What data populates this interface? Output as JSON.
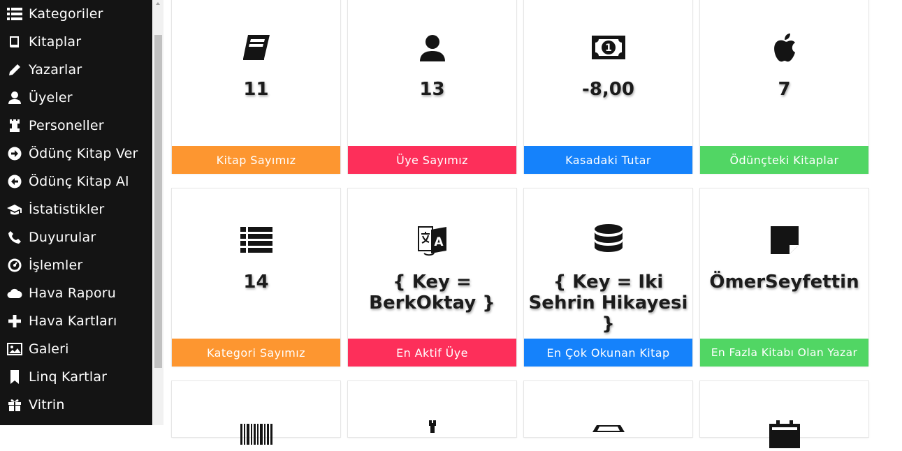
{
  "sidebar": {
    "items": [
      {
        "label": "Kategoriler",
        "icon": "list-icon"
      },
      {
        "label": "Kitaplar",
        "icon": "book-icon"
      },
      {
        "label": "Yazarlar",
        "icon": "pencil-icon"
      },
      {
        "label": "Üyeler",
        "icon": "user-icon"
      },
      {
        "label": "Personeller",
        "icon": "tower-icon"
      },
      {
        "label": "Ödünç Kitap Ver",
        "icon": "circle-arrow-right-icon"
      },
      {
        "label": "Ödünç Kitap Al",
        "icon": "circle-arrow-left-icon"
      },
      {
        "label": "İstatistikler",
        "icon": "education-icon"
      },
      {
        "label": "Duyurular",
        "icon": "phone-icon"
      },
      {
        "label": "İşlemler",
        "icon": "dashboard-icon"
      },
      {
        "label": "Hava Raporu",
        "icon": "cloud-icon"
      },
      {
        "label": "Hava Kartları",
        "icon": "plus-icon"
      },
      {
        "label": "Galeri",
        "icon": "picture-icon"
      },
      {
        "label": "Linq Kartlar",
        "icon": "bookmark-icon"
      },
      {
        "label": "Vitrin",
        "icon": "gift-icon"
      }
    ]
  },
  "cards": [
    {
      "value": "11",
      "label": "Kitap Sayımız",
      "icon": "book-icon",
      "color": "#fd9630"
    },
    {
      "value": "13",
      "label": "Üye Sayımız",
      "icon": "user-icon",
      "color": "#fd2f5a"
    },
    {
      "value": "-8,00",
      "label": "Kasadaki Tutar",
      "icon": "money-icon",
      "color": "#1582fb"
    },
    {
      "value": "7",
      "label": "Ödünçteki Kitaplar",
      "icon": "apple-icon",
      "color": "#51d664"
    },
    {
      "value": "14",
      "label": "Kategori Sayımız",
      "icon": "list-icon",
      "color": "#fd9630"
    },
    {
      "value": "{ Key = BerkOktay }",
      "label": "En Aktif Üye",
      "icon": "translate-icon",
      "color": "#fd2f5a"
    },
    {
      "value": "{ Key = Iki Sehrin Hikayesi }",
      "label": "En Çok Okunan Kitap",
      "icon": "database-icon",
      "color": "#1582fb"
    },
    {
      "value": "ÖmerSeyfettin",
      "label": "En Fazla Kitabı Olan Yazar",
      "icon": "note-icon",
      "color": "#51d664"
    }
  ],
  "partial_cards": [
    {
      "icon": "barcode-icon"
    },
    {
      "icon": "tower-icon"
    },
    {
      "icon": "shop-icon"
    },
    {
      "icon": "calendar-icon"
    }
  ]
}
